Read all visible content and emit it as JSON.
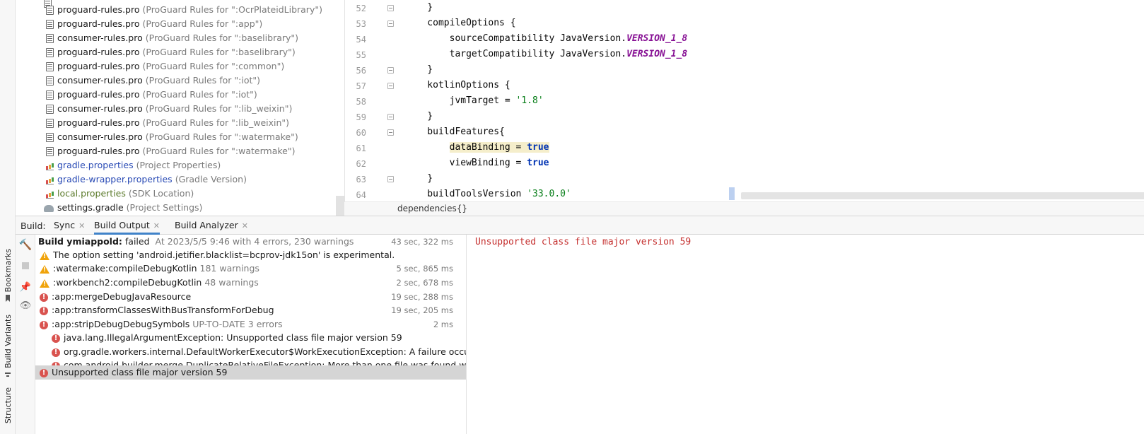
{
  "side_tabs": {
    "bookmarks": "Bookmarks",
    "build_variants": "Build Variants",
    "structure": "Structure"
  },
  "tree": {
    "items": [
      {
        "icon": "proguard-file-icon",
        "name": "proguard-rules.pro",
        "desc": "(ProGuard Rules for \":OcrPlateidLibrary\")"
      },
      {
        "icon": "proguard-file-icon",
        "name": "proguard-rules.pro",
        "desc": "(ProGuard Rules for \":app\")"
      },
      {
        "icon": "proguard-file-icon",
        "name": "consumer-rules.pro",
        "desc": "(ProGuard Rules for \":baselibrary\")"
      },
      {
        "icon": "proguard-file-icon",
        "name": "proguard-rules.pro",
        "desc": "(ProGuard Rules for \":baselibrary\")"
      },
      {
        "icon": "proguard-file-icon",
        "name": "proguard-rules.pro",
        "desc": "(ProGuard Rules for \":common\")"
      },
      {
        "icon": "proguard-file-icon",
        "name": "consumer-rules.pro",
        "desc": "(ProGuard Rules for \":iot\")"
      },
      {
        "icon": "proguard-file-icon",
        "name": "proguard-rules.pro",
        "desc": "(ProGuard Rules for \":iot\")"
      },
      {
        "icon": "proguard-file-icon",
        "name": "consumer-rules.pro",
        "desc": "(ProGuard Rules for \":lib_weixin\")"
      },
      {
        "icon": "proguard-file-icon",
        "name": "proguard-rules.pro",
        "desc": "(ProGuard Rules for \":lib_weixin\")"
      },
      {
        "icon": "proguard-file-icon",
        "name": "consumer-rules.pro",
        "desc": "(ProGuard Rules for \":watermake\")"
      },
      {
        "icon": "proguard-file-icon",
        "name": "proguard-rules.pro",
        "desc": "(ProGuard Rules for \":watermake\")"
      },
      {
        "icon": "properties-file-icon",
        "name": "gradle.properties",
        "desc": "(Project Properties)"
      },
      {
        "icon": "properties-file-icon",
        "name": "gradle-wrapper.properties",
        "desc": "(Gradle Version)"
      },
      {
        "icon": "properties-file-icon",
        "name": "local.properties",
        "desc": "(SDK Location)"
      },
      {
        "icon": "gradle-file-icon",
        "name": "settings.gradle",
        "desc": "(Project Settings)"
      }
    ]
  },
  "editor": {
    "lines": [
      {
        "num": "52",
        "plain": "    }"
      },
      {
        "num": "53",
        "plain": "    compileOptions {"
      },
      {
        "num": "54",
        "a": "        sourceCompatibility JavaVersion.",
        "b": "VERSION_1_8"
      },
      {
        "num": "55",
        "a": "        targetCompatibility JavaVersion.",
        "b": "VERSION_1_8"
      },
      {
        "num": "56",
        "plain": "    }"
      },
      {
        "num": "57",
        "plain": "    kotlinOptions {"
      },
      {
        "num": "58",
        "a": "        jvmTarget = ",
        "b": "'1.8'"
      },
      {
        "num": "59",
        "plain": "    }"
      },
      {
        "num": "60",
        "plain": "    buildFeatures{"
      },
      {
        "num": "61",
        "a": "dataBinding = ",
        "b": "true"
      },
      {
        "num": "62",
        "a": "        viewBinding = ",
        "b": "true"
      },
      {
        "num": "63",
        "plain": "    }"
      },
      {
        "num": "64",
        "a": "    buildToolsVersion ",
        "b": "'33.0.0'"
      }
    ],
    "breadcrumb": "dependencies{}"
  },
  "build": {
    "label": "Build:",
    "tabs": {
      "sync": "Sync",
      "output": "Build Output",
      "analyzer": "Build Analyzer"
    },
    "rows": [
      {
        "icon": "hammer-icon",
        "title": "Build ymiappold:",
        "rest": "failed",
        "meta": "At 2023/5/5 9:46 with 4 errors, 230 warnings",
        "time": "43 sec, 322 ms"
      },
      {
        "icon": "warning-icon",
        "title": "The option setting 'android.jetifier.blacklist=bcprov-jdk15on' is experimental.",
        "meta": "",
        "time": ""
      },
      {
        "icon": "warning-icon",
        "title": ":watermake:compileDebugKotlin",
        "meta": "181 warnings",
        "time": "5 sec, 865 ms"
      },
      {
        "icon": "warning-icon",
        "title": ":workbench2:compileDebugKotlin",
        "meta": "48 warnings",
        "time": "2 sec, 678 ms"
      },
      {
        "icon": "error-icon",
        "title": ":app:mergeDebugJavaResource",
        "meta": "",
        "time": "19 sec, 288 ms"
      },
      {
        "icon": "error-icon",
        "title": ":app:transformClassesWithBusTransformForDebug",
        "meta": "",
        "time": "19 sec, 205 ms"
      },
      {
        "icon": "error-icon",
        "title": ":app:stripDebugDebugSymbols",
        "meta": "UP-TO-DATE 3 errors",
        "time": "2 ms"
      },
      {
        "icon": "error-icon",
        "title": "java.lang.IllegalArgumentException: Unsupported class file major version 59",
        "meta": "",
        "time": ""
      },
      {
        "icon": "error-icon",
        "title": "org.gradle.workers.internal.DefaultWorkerExecutor$WorkExecutionException: A failure occurred w",
        "meta": "",
        "time": ""
      },
      {
        "icon": "error-icon",
        "title": "com.android.builder.merge.DuplicateRelativeFileException: More than one file was found with OS i",
        "meta": "",
        "time": ""
      },
      {
        "icon": "error-icon",
        "title": "Unsupported class file major version 59",
        "meta": "",
        "time": ""
      }
    ],
    "detail_message": "Unsupported class file major version 59"
  }
}
